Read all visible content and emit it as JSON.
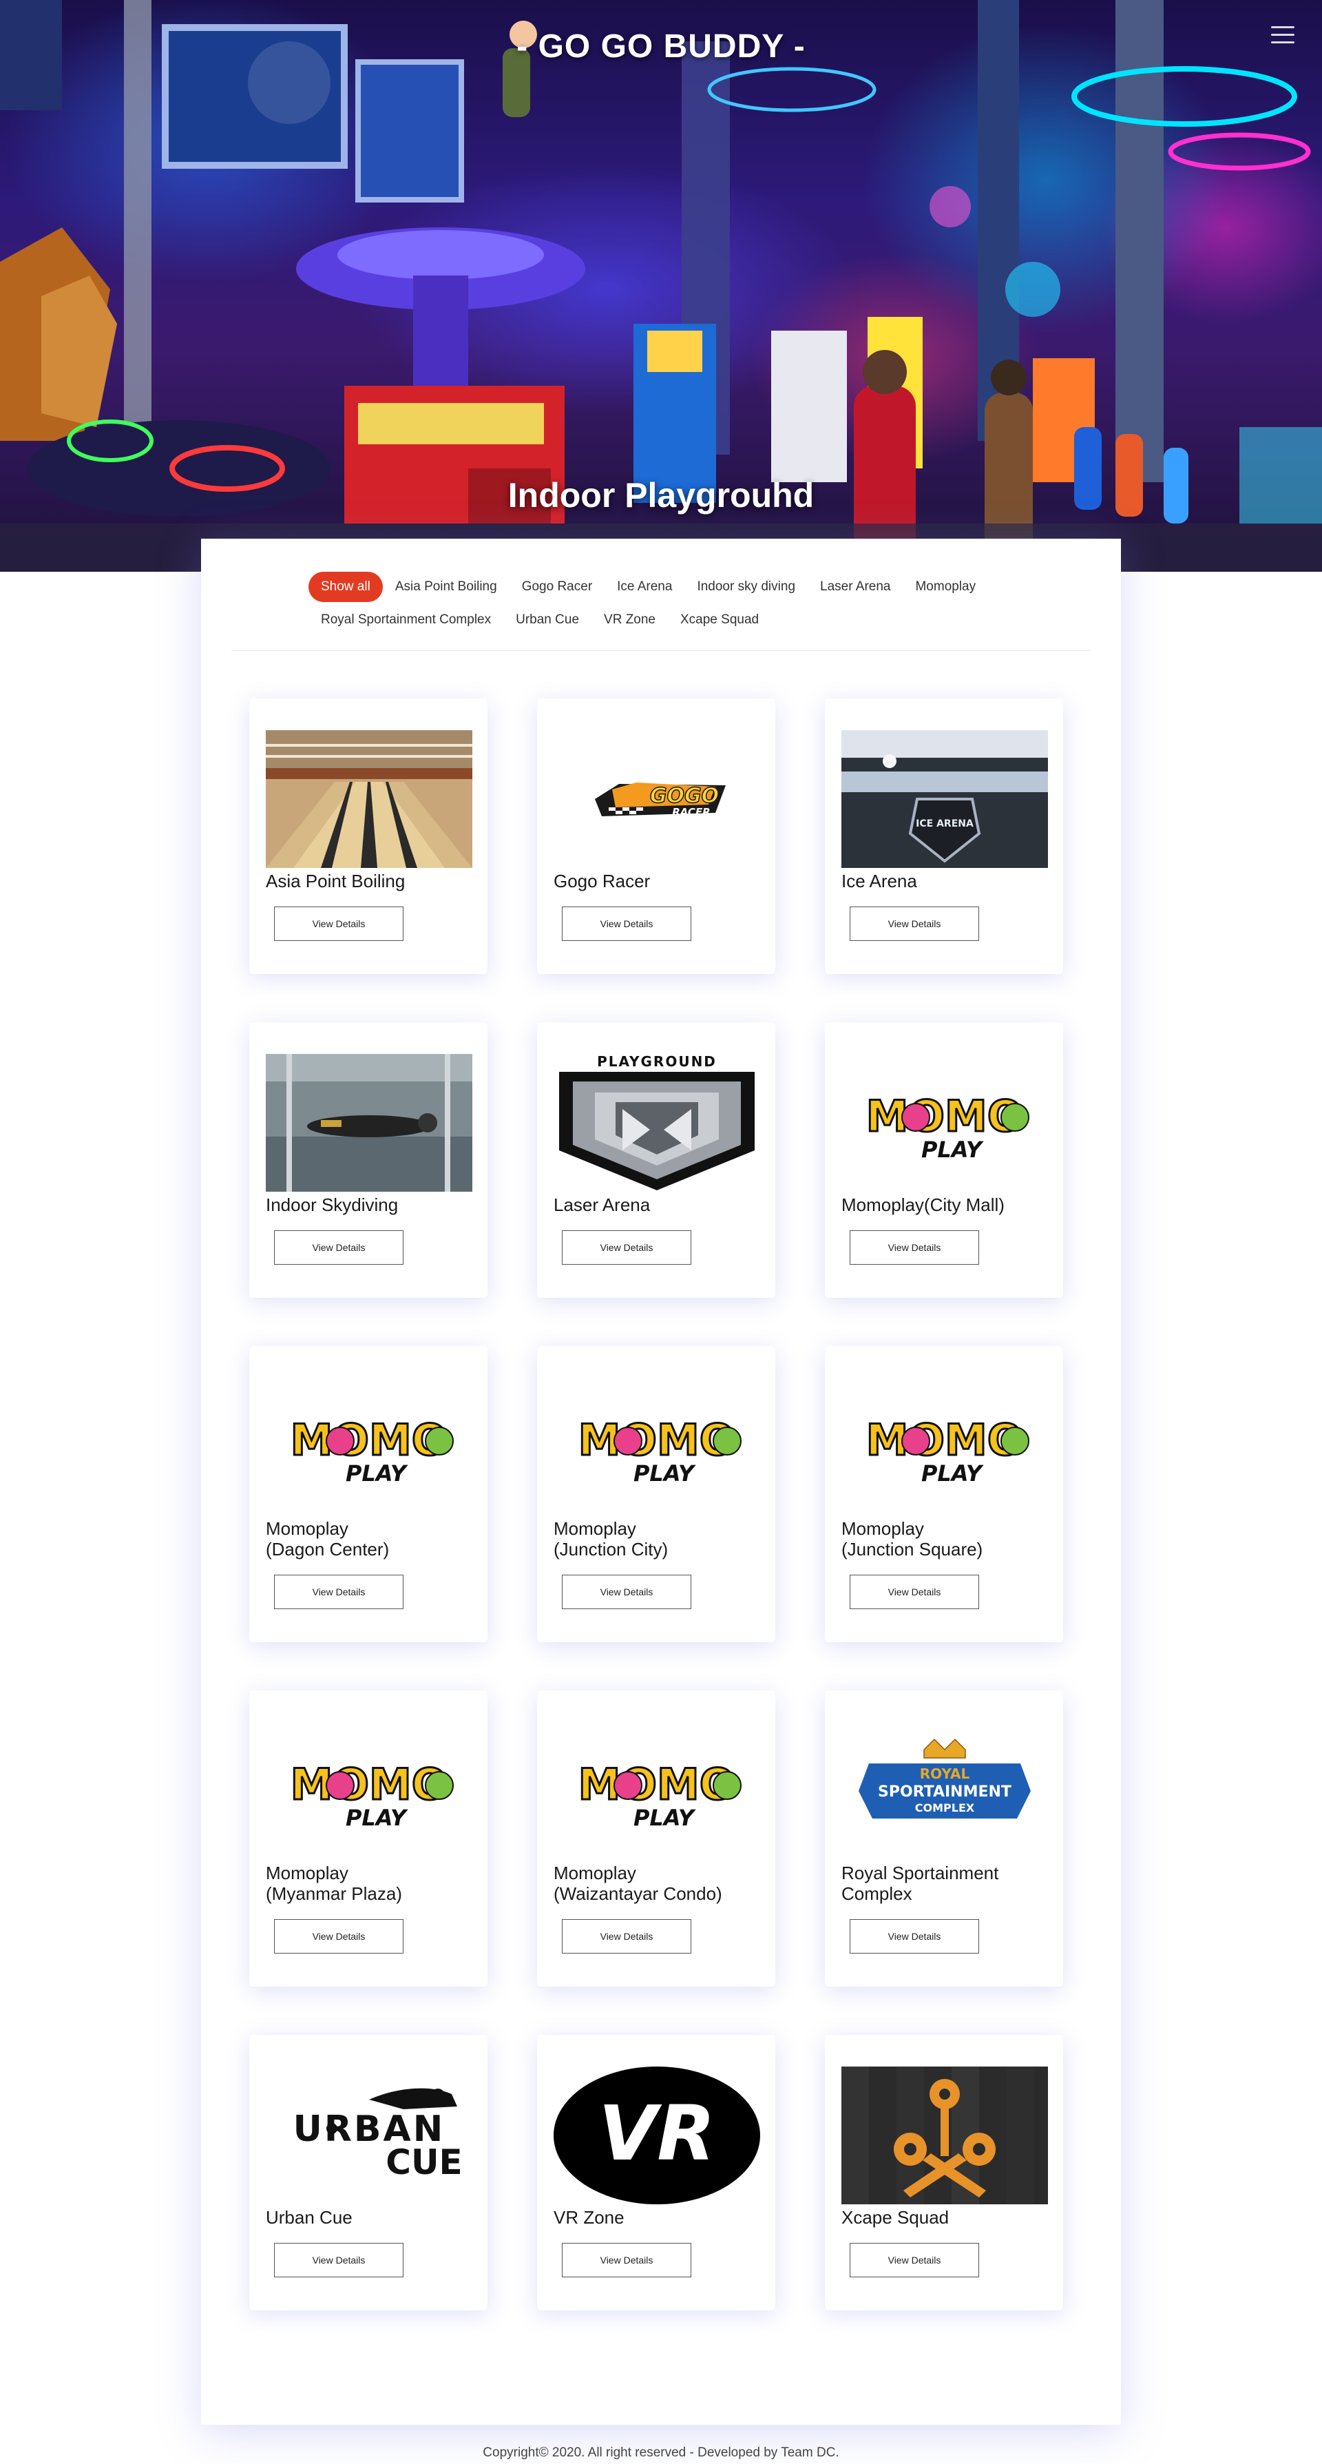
{
  "site": {
    "title": "- GO GO BUDDY -",
    "subtitle": "Indoor Playgrouhd"
  },
  "filters": {
    "row1": [
      "Show all",
      "Asia Point Boiling",
      "Gogo Racer",
      "Ice Arena",
      "Indoor sky diving",
      "Laser Arena",
      "Momoplay"
    ],
    "row2": [
      "Royal Sportainment Complex",
      "Urban Cue",
      "VR Zone",
      "Xcape Squad"
    ],
    "active": "Show all"
  },
  "cards": [
    {
      "name": "Asia Point Boiling",
      "image": "bowling-alley-photo",
      "button": "View Details"
    },
    {
      "name": "Gogo Racer",
      "image": "gogo-racer-logo",
      "button": "View Details"
    },
    {
      "name": "Ice Arena",
      "image": "ice-arena-photo",
      "button": "View Details"
    },
    {
      "name": "Indoor Skydiving",
      "image": "skydiving-photo",
      "button": "View Details"
    },
    {
      "name": "Laser Arena",
      "image": "playground-shield-logo",
      "button": "View Details"
    },
    {
      "name": "Momoplay(City Mall)",
      "image": "momoplay-logo",
      "button": "View Details"
    },
    {
      "name": "Momoplay\n(Dagon Center)",
      "image": "momoplay-logo",
      "button": "View Details"
    },
    {
      "name": "Momoplay\n(Junction City)",
      "image": "momoplay-logo",
      "button": "View Details"
    },
    {
      "name": "Momoplay\n(Junction Square)",
      "image": "momoplay-logo",
      "button": "View Details"
    },
    {
      "name": "Momoplay\n(Myanmar Plaza)",
      "image": "momoplay-logo",
      "button": "View Details"
    },
    {
      "name": "Momoplay\n(Waizantayar Condo)",
      "image": "momoplay-logo",
      "button": "View Details"
    },
    {
      "name": "Royal Sportainment\nComplex",
      "image": "royal-sportainment-logo",
      "button": "View Details"
    },
    {
      "name": "Urban Cue",
      "image": "urban-cue-logo",
      "button": "View Details"
    },
    {
      "name": "VR Zone",
      "image": "vr-logo",
      "button": "View Details"
    },
    {
      "name": "Xcape Squad",
      "image": "xcape-keys-photo",
      "button": "View Details"
    }
  ],
  "logo_text": {
    "gogo_racer": "GOGO",
    "gogo_racer_sub": "RACER",
    "playground": "PLAYGROUND",
    "momo": "MOMO",
    "play": "PLAY",
    "royal": "ROYAL",
    "sportainment": "SPORTAINMENT",
    "complex": "COMPLEX",
    "urban": "URBAN",
    "cue": "CUE",
    "vr": "VR",
    "ice_arena": "ICE ARENA"
  },
  "colors": {
    "accent": "#e23b22",
    "momo_yellow": "#f6c21b",
    "momo_pink": "#e8408a",
    "momo_green": "#7cc242",
    "royal_blue": "#1e5fb3",
    "royal_gold": "#e8a726"
  },
  "footer": "Copyright© 2020. All right reserved - Developed by Team DC."
}
